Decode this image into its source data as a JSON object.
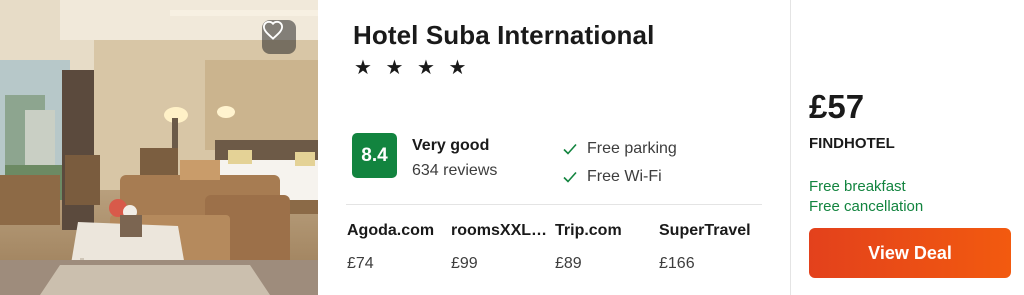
{
  "hotel": {
    "name": "Hotel Suba International",
    "stars": "★ ★ ★ ★",
    "star_rating": 4,
    "photo_icon": "hotel-room-photo"
  },
  "favorite": {
    "icon": "heart-icon"
  },
  "rating": {
    "score": "8.4",
    "label": "Very good",
    "reviews": "634 reviews",
    "color": "#12843f"
  },
  "amenities": [
    {
      "label": "Free parking",
      "icon": "check-icon"
    },
    {
      "label": "Free Wi-Fi",
      "icon": "check-icon"
    }
  ],
  "providers": [
    {
      "name": "Agoda.com",
      "price": "£74"
    },
    {
      "name": "roomsXXL…",
      "price": "£99"
    },
    {
      "name": "Trip.com",
      "price": "£89"
    },
    {
      "name": "SuperTravel",
      "price": "£166"
    }
  ],
  "deal": {
    "price": "£57",
    "provider": "FINDHOTEL",
    "perks": [
      "Free breakfast",
      "Free cancellation"
    ],
    "button_label": "View Deal",
    "button_color": "#eb4d17",
    "perk_color": "#12843f"
  }
}
